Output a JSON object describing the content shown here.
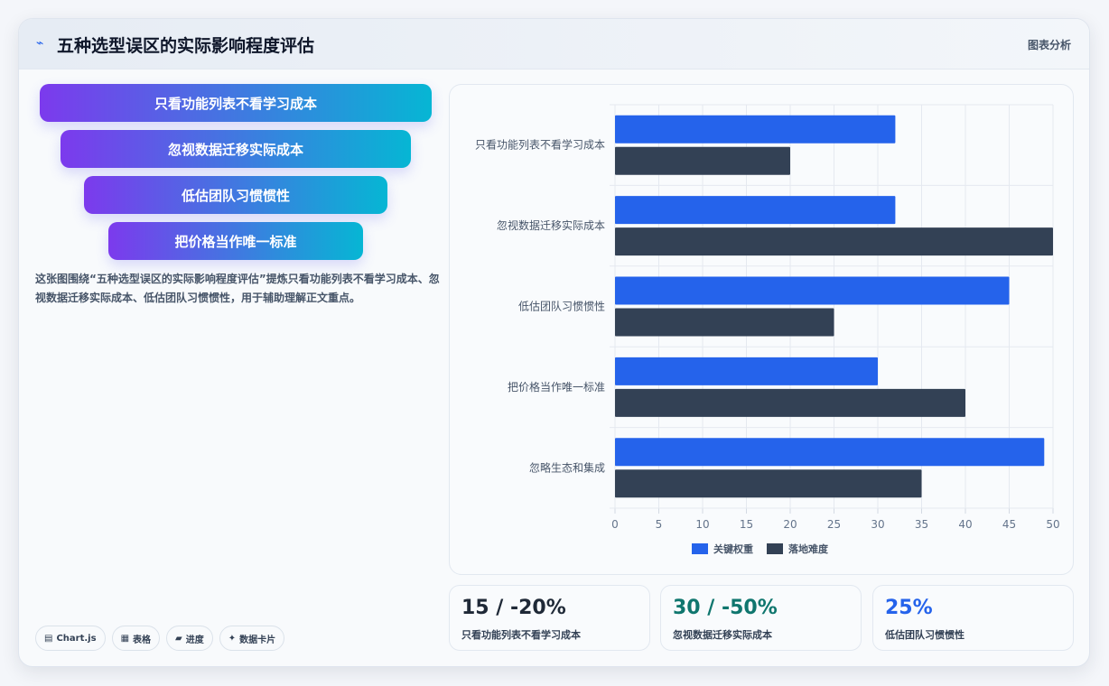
{
  "header": {
    "icon": "chart-line-icon",
    "title": "五种选型误区的实际影响程度评估",
    "right_label": "图表分析"
  },
  "pills": [
    "只看功能列表不看学习成本",
    "忽视数据迁移实际成本",
    "低估团队习惯惯性",
    "把价格当作唯一标准"
  ],
  "description": "这张图围绕“五种选型误区的实际影响程度评估”提炼只看功能列表不看学习成本、忽视数据迁移实际成本、低估团队习惯惯性，用于辅助理解正文重点。",
  "tags": [
    {
      "icon": "window-icon",
      "label": "Chart.js"
    },
    {
      "icon": "table-icon",
      "label": "表格"
    },
    {
      "icon": "progress-icon",
      "label": "进度"
    },
    {
      "icon": "sparkle-icon",
      "label": "数据卡片"
    }
  ],
  "kpis": [
    {
      "value": "15 / -20%",
      "label": "只看功能列表不看学习成本",
      "color": "#1f2937"
    },
    {
      "value": "30 / -50%",
      "label": "忽视数据迁移实际成本",
      "color": "#0f766e"
    },
    {
      "value": "25%",
      "label": "低估团队习惯惯性",
      "color": "#2563eb"
    }
  ],
  "chart_data": {
    "type": "bar",
    "orientation": "horizontal",
    "categories": [
      "只看功能列表不看学习成本",
      "忽视数据迁移实际成本",
      "低估团队习惯惯性",
      "把价格当作唯一标准",
      "忽略生态和集成"
    ],
    "series": [
      {
        "name": "关键权重",
        "color": "#2563eb",
        "values": [
          32,
          32,
          45,
          30,
          49
        ]
      },
      {
        "name": "落地难度",
        "color": "#334155",
        "values": [
          20,
          50,
          25,
          40,
          35
        ]
      }
    ],
    "xlim": [
      0,
      50
    ],
    "xticks": [
      0,
      5,
      10,
      15,
      20,
      25,
      30,
      35,
      40,
      45,
      50
    ],
    "grid": true,
    "legend": "bottom"
  }
}
